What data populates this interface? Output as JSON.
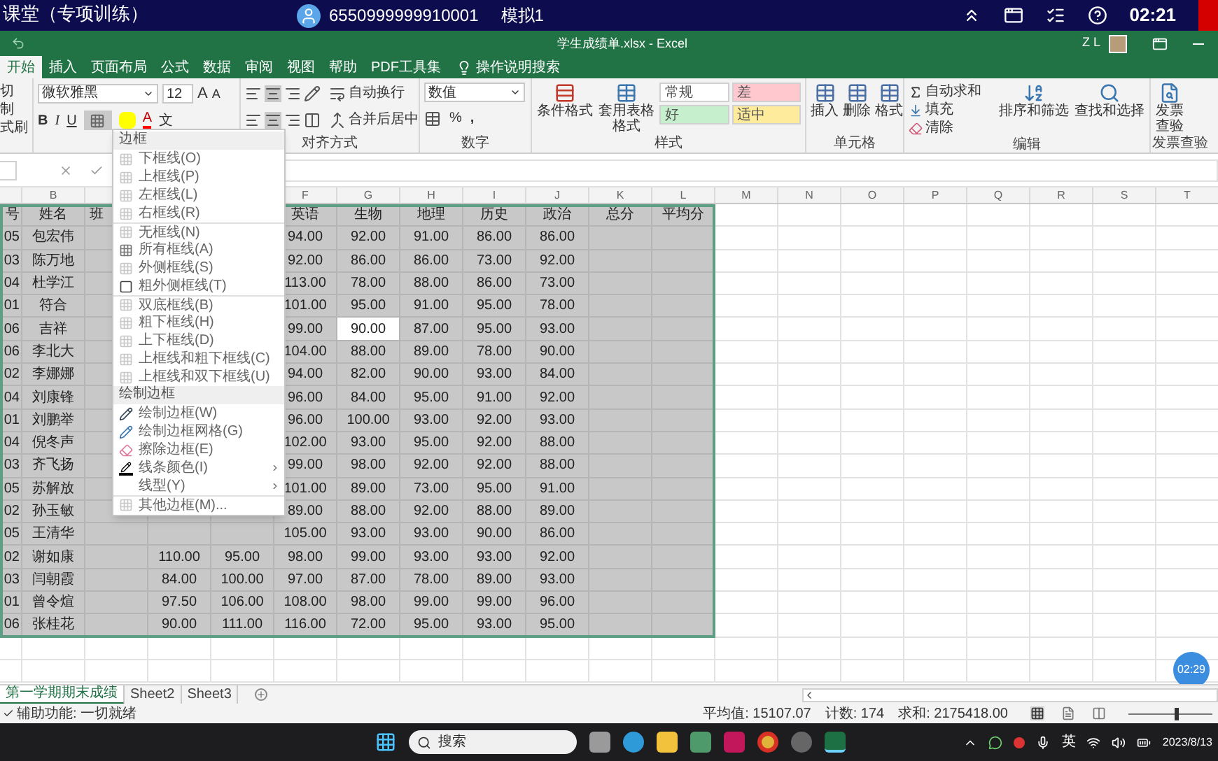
{
  "top_bar": {
    "title": "课堂（专项训练）",
    "account": "6550999999910001",
    "mode": "模拟1",
    "clock": "02:21"
  },
  "title_bar": {
    "title": "学生成绩单.xlsx  -  Excel",
    "user": "Z L"
  },
  "tabs": [
    {
      "label": "开始",
      "selected": true
    },
    {
      "label": "插入",
      "selected": false
    },
    {
      "label": "页面布局",
      "selected": false
    },
    {
      "label": "公式",
      "selected": false
    },
    {
      "label": "数据",
      "selected": false
    },
    {
      "label": "审阅",
      "selected": false
    },
    {
      "label": "视图",
      "selected": false
    },
    {
      "label": "帮助",
      "selected": false
    },
    {
      "label": "PDF工具集",
      "selected": false
    }
  ],
  "tell_me": "操作说明搜索",
  "ribbon": {
    "clipboard": [
      "切",
      "制",
      "式刷"
    ],
    "font": {
      "name": "微软雅黑",
      "size": "12",
      "grow": "A",
      "shrink": "A",
      "bold": "B",
      "italic": "I",
      "underline": "U",
      "text_color_letter": "A",
      "phonetic": "文"
    },
    "alignment": {
      "wrap": "自动换行",
      "merge": "合并后居中",
      "label": "对齐方式"
    },
    "number": {
      "format": "数值",
      "percent": "%",
      "comma": ",",
      "label": "数字"
    },
    "styles": {
      "buttons": [
        "条件格式",
        "套用表格格式"
      ],
      "cells": [
        {
          "label": "常规",
          "color": "#ffffff"
        },
        {
          "label": "差",
          "color": "#ffc7ce"
        },
        {
          "label": "好",
          "color": "#c6efce"
        },
        {
          "label": "适中",
          "color": "#ffeb9c"
        }
      ],
      "label": "样式"
    },
    "cells": {
      "buttons": [
        "插入",
        "删除",
        "格式"
      ],
      "label": "单元格"
    },
    "editing": {
      "items": [
        "自动求和",
        "填充",
        "清除"
      ],
      "buttons": [
        "排序和筛选",
        "查找和选择"
      ],
      "label": "编辑"
    },
    "invoice": {
      "button": "发票查验",
      "label": "发票查验"
    }
  },
  "column_headers_left": [
    "B"
  ],
  "column_headers_right": [
    "F",
    "G",
    "H",
    "I",
    "J",
    "K",
    "L",
    "M",
    "N",
    "O",
    "P",
    "Q",
    "R",
    "S",
    "T"
  ],
  "rows": [
    {
      "selected": true,
      "cells": [
        "号",
        "姓名",
        "班",
        null,
        null,
        "英语",
        "生物",
        "地理",
        "历史",
        "政治",
        "总分",
        "平均分"
      ]
    },
    {
      "selected": true,
      "cells": [
        "05",
        "包宏伟",
        null,
        null,
        null,
        "94.00",
        "92.00",
        "91.00",
        "86.00",
        "86.00",
        null,
        null
      ]
    },
    {
      "selected": true,
      "cells": [
        "03",
        "陈万地",
        null,
        null,
        null,
        "92.00",
        "86.00",
        "86.00",
        "73.00",
        "92.00",
        null,
        null
      ]
    },
    {
      "selected": true,
      "cells": [
        "04",
        "杜学江",
        null,
        null,
        null,
        "113.00",
        "78.00",
        "88.00",
        "86.00",
        "73.00",
        null,
        null
      ]
    },
    {
      "selected": true,
      "cells": [
        "01",
        "符合",
        null,
        null,
        null,
        "101.00",
        "95.00",
        "91.00",
        "95.00",
        "78.00",
        null,
        null
      ]
    },
    {
      "selected": true,
      "cells": [
        "06",
        "吉祥",
        null,
        null,
        null,
        "99.00",
        {
          "text": "90.00",
          "active": true
        },
        "87.00",
        "95.00",
        "93.00",
        null,
        null
      ]
    },
    {
      "selected": true,
      "cells": [
        "06",
        "李北大",
        null,
        null,
        null,
        "104.00",
        "88.00",
        "89.00",
        "78.00",
        "90.00",
        null,
        null
      ]
    },
    {
      "selected": true,
      "cells": [
        "02",
        "李娜娜",
        null,
        null,
        null,
        "94.00",
        "82.00",
        "90.00",
        "93.00",
        "84.00",
        null,
        null
      ]
    },
    {
      "selected": true,
      "cells": [
        "04",
        "刘康锋",
        null,
        null,
        null,
        "96.00",
        "84.00",
        "95.00",
        "91.00",
        "92.00",
        null,
        null
      ]
    },
    {
      "selected": true,
      "cells": [
        "01",
        "刘鹏举",
        null,
        null,
        null,
        "96.00",
        "100.00",
        "93.00",
        "92.00",
        "93.00",
        null,
        null
      ]
    },
    {
      "selected": true,
      "cells": [
        "04",
        "倪冬声",
        null,
        null,
        null,
        "102.00",
        "93.00",
        "95.00",
        "92.00",
        "88.00",
        null,
        null
      ]
    },
    {
      "selected": true,
      "cells": [
        "03",
        "齐飞扬",
        null,
        null,
        null,
        "99.00",
        "98.00",
        "92.00",
        "92.00",
        "88.00",
        null,
        null
      ]
    },
    {
      "selected": true,
      "cells": [
        "05",
        "苏解放",
        null,
        null,
        null,
        "101.00",
        "89.00",
        "73.00",
        "95.00",
        "91.00",
        null,
        null
      ]
    },
    {
      "selected": true,
      "cells": [
        "02",
        "孙玉敏",
        null,
        null,
        null,
        "89.00",
        "88.00",
        "92.00",
        "88.00",
        "89.00",
        null,
        null
      ]
    },
    {
      "selected": true,
      "cells": [
        "05",
        "王清华",
        null,
        null,
        null,
        "105.00",
        "93.00",
        "93.00",
        "90.00",
        "86.00",
        null,
        null
      ]
    },
    {
      "selected": true,
      "cells": [
        "02",
        "谢如康",
        null,
        "110.00",
        "95.00",
        "98.00",
        "99.00",
        "93.00",
        "93.00",
        "92.00",
        null,
        null
      ]
    },
    {
      "selected": true,
      "cells": [
        "03",
        "闫朝霞",
        null,
        "84.00",
        "100.00",
        "97.00",
        "87.00",
        "78.00",
        "89.00",
        "93.00",
        null,
        null
      ]
    },
    {
      "selected": true,
      "cells": [
        "01",
        "曾令煊",
        null,
        "97.50",
        "106.00",
        "108.00",
        "98.00",
        "99.00",
        "99.00",
        "96.00",
        null,
        null
      ]
    },
    {
      "selected": true,
      "cells": [
        "06",
        "张桂花",
        null,
        "90.00",
        "111.00",
        "116.00",
        "72.00",
        "95.00",
        "93.00",
        "95.00",
        null,
        null
      ]
    }
  ],
  "border_menu": [
    {
      "title": "边框",
      "items": [
        {
          "label": "下框线(O)",
          "divider": false,
          "submenu": false
        },
        {
          "label": "上框线(P)",
          "divider": false,
          "submenu": false
        },
        {
          "label": "左框线(L)",
          "divider": false,
          "submenu": false
        },
        {
          "label": "右框线(R)",
          "divider": false,
          "submenu": false
        },
        {
          "label": "无框线(N)",
          "divider": true,
          "submenu": false
        },
        {
          "label": "所有框线(A)",
          "divider": false,
          "submenu": false
        },
        {
          "label": "外侧框线(S)",
          "divider": false,
          "submenu": false
        },
        {
          "label": "粗外侧框线(T)",
          "divider": false,
          "submenu": false
        },
        {
          "label": "双底框线(B)",
          "divider": true,
          "submenu": false
        },
        {
          "label": "粗下框线(H)",
          "divider": false,
          "submenu": false
        },
        {
          "label": "上下框线(D)",
          "divider": false,
          "submenu": false
        },
        {
          "label": "上框线和粗下框线(C)",
          "divider": false,
          "submenu": false
        },
        {
          "label": "上框线和双下框线(U)",
          "divider": false,
          "submenu": false
        }
      ]
    },
    {
      "title": "绘制边框",
      "items": [
        {
          "label": "绘制边框(W)",
          "divider": false,
          "submenu": false
        },
        {
          "label": "绘制边框网格(G)",
          "divider": false,
          "submenu": false
        },
        {
          "label": "擦除边框(E)",
          "divider": false,
          "submenu": false
        },
        {
          "label": "线条颜色(I)",
          "divider": false,
          "submenu": true
        },
        {
          "label": "线型(Y)",
          "divider": false,
          "submenu": true
        },
        {
          "label": "其他边框(M)...",
          "divider": true,
          "submenu": false
        }
      ]
    }
  ],
  "sheet_tabs": [
    {
      "label": "第一学期期末成绩",
      "selected": true
    },
    {
      "label": "Sheet2",
      "selected": false
    },
    {
      "label": "Sheet3",
      "selected": false
    }
  ],
  "timer_badge": "02:29",
  "status": {
    "accessibility": "辅助功能: 一切就绪",
    "average": "平均值: 15107.07",
    "count": "计数: 174",
    "sum": "求和: 2175418.00",
    "zoom_slider": {
      "level": 0.55
    }
  },
  "taskbar": {
    "search": "搜索",
    "ime": "英",
    "date": "2023/8/13"
  }
}
